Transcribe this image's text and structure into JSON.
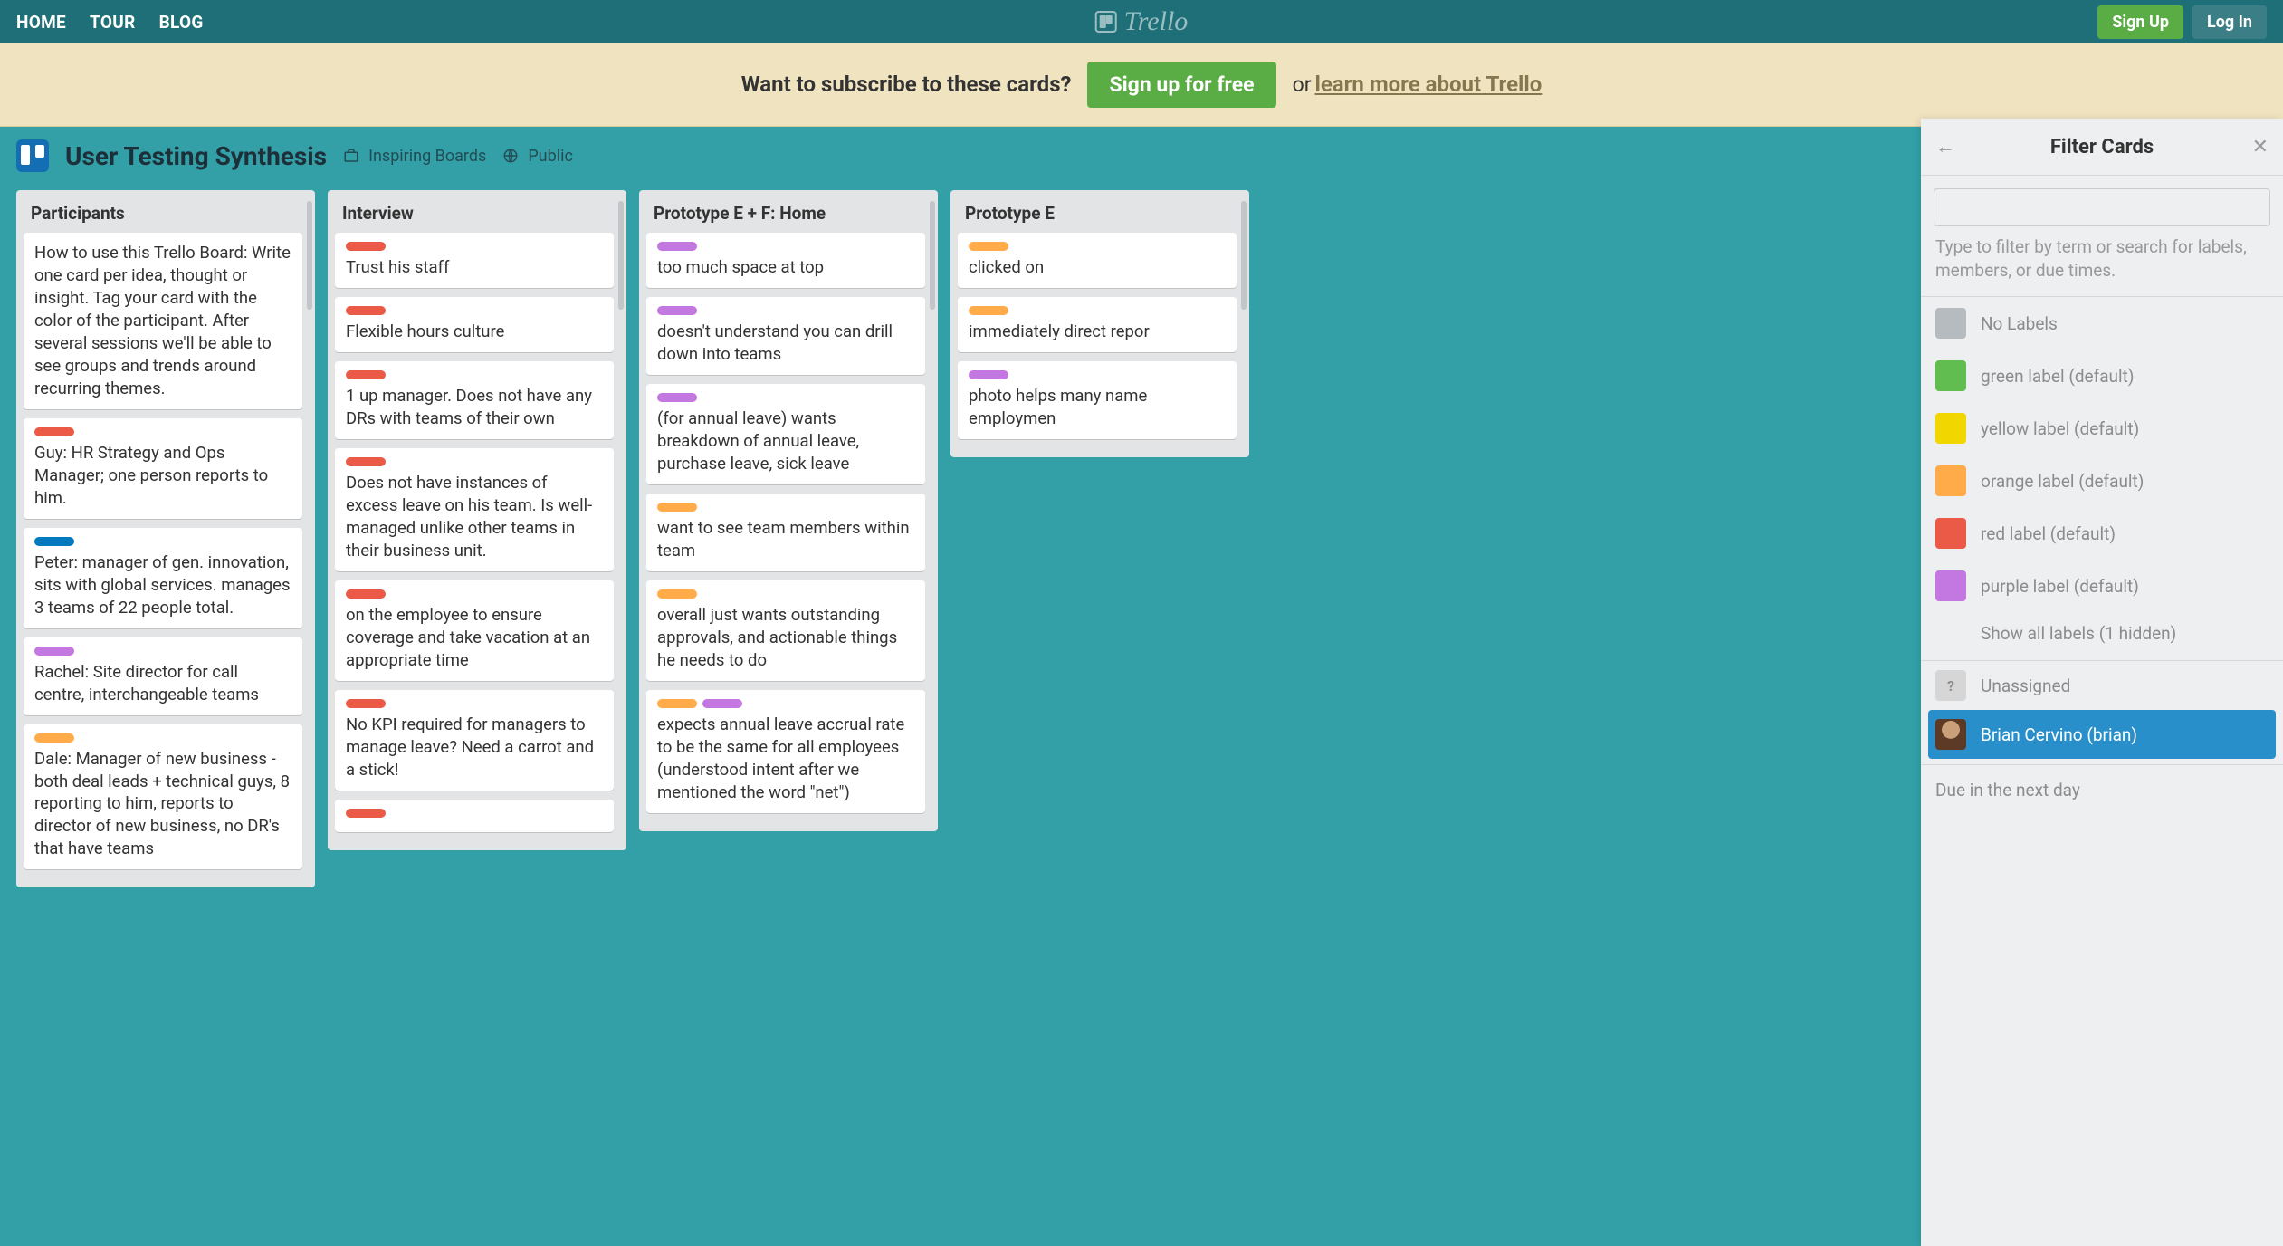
{
  "topbar": {
    "links": [
      "HOME",
      "TOUR",
      "BLOG"
    ],
    "brand": "Trello",
    "signup": "Sign Up",
    "login": "Log In"
  },
  "banner": {
    "question": "Want to subscribe to these cards?",
    "cta": "Sign up for free",
    "or": "or",
    "learn": "learn more about Trello"
  },
  "board": {
    "title": "User Testing Synthesis",
    "org": "Inspiring Boards",
    "visibility": "Public"
  },
  "lists": [
    {
      "title": "Participants",
      "cards": [
        {
          "labels": [],
          "text": "How to use this Trello Board: Write one card per idea, thought or insight. Tag your card with the color of the participant. After several sessions we'll be able to see groups and trends around recurring themes."
        },
        {
          "labels": [
            "red"
          ],
          "text": "Guy: HR Strategy and Ops Manager; one person reports to him."
        },
        {
          "labels": [
            "blue"
          ],
          "text": "Peter: manager of gen. innovation, sits with global services. manages 3 teams of 22 people total."
        },
        {
          "labels": [
            "purple"
          ],
          "text": "Rachel: Site director for call centre, interchangeable teams"
        },
        {
          "labels": [
            "orange"
          ],
          "text": "Dale: Manager of new business - both deal leads + technical guys, 8 reporting to him, reports to director of new business, no DR's that have teams"
        }
      ]
    },
    {
      "title": "Interview",
      "cards": [
        {
          "labels": [
            "red"
          ],
          "text": "Trust his staff"
        },
        {
          "labels": [
            "red"
          ],
          "text": "Flexible hours culture"
        },
        {
          "labels": [
            "red"
          ],
          "text": "1 up manager. Does not have any DRs with teams of their own"
        },
        {
          "labels": [
            "red"
          ],
          "text": "Does not have instances of excess leave on his team. Is well-managed unlike other teams in their business unit."
        },
        {
          "labels": [
            "red"
          ],
          "text": "on the employee to ensure coverage and take vacation at an appropriate time"
        },
        {
          "labels": [
            "red"
          ],
          "text": "No KPI required for managers to manage leave? Need a carrot and a stick!"
        },
        {
          "labels": [
            "red"
          ],
          "text": ""
        }
      ]
    },
    {
      "title": "Prototype E + F: Home",
      "cards": [
        {
          "labels": [
            "purple"
          ],
          "text": "too much space at top"
        },
        {
          "labels": [
            "purple"
          ],
          "text": "doesn't understand you can drill down into teams"
        },
        {
          "labels": [
            "purple"
          ],
          "text": "(for annual leave) wants breakdown of annual leave, purchase leave, sick leave"
        },
        {
          "labels": [
            "orange"
          ],
          "text": "want to see team members within team"
        },
        {
          "labels": [
            "orange"
          ],
          "text": "overall just wants outstanding approvals, and actionable things he needs to do"
        },
        {
          "labels": [
            "orange",
            "purple"
          ],
          "text": "expects annual leave accrual rate to be the same for all employees (understood intent after we mentioned the word \"net\")"
        }
      ]
    },
    {
      "title": "Prototype E",
      "cards": [
        {
          "labels": [
            "orange"
          ],
          "text": "clicked on"
        },
        {
          "labels": [
            "orange"
          ],
          "text": "immediately direct repor"
        },
        {
          "labels": [
            "purple"
          ],
          "text": "photo helps many name employmen"
        }
      ]
    }
  ],
  "filter": {
    "title": "Filter Cards",
    "hint": "Type to filter by term or search for labels, members, or due times.",
    "labels": [
      {
        "swatch": "gray",
        "text": "No Labels"
      },
      {
        "swatch": "green",
        "text": "green label (default)"
      },
      {
        "swatch": "yellow",
        "text": "yellow label (default)"
      },
      {
        "swatch": "orange",
        "text": "orange label (default)"
      },
      {
        "swatch": "red",
        "text": "red label (default)"
      },
      {
        "swatch": "purple",
        "text": "purple label (default)"
      }
    ],
    "show_all": "Show all labels (1 hidden)",
    "unassigned": "Unassigned",
    "member": "Brian Cervino (brian)",
    "due": "Due in the next day"
  }
}
